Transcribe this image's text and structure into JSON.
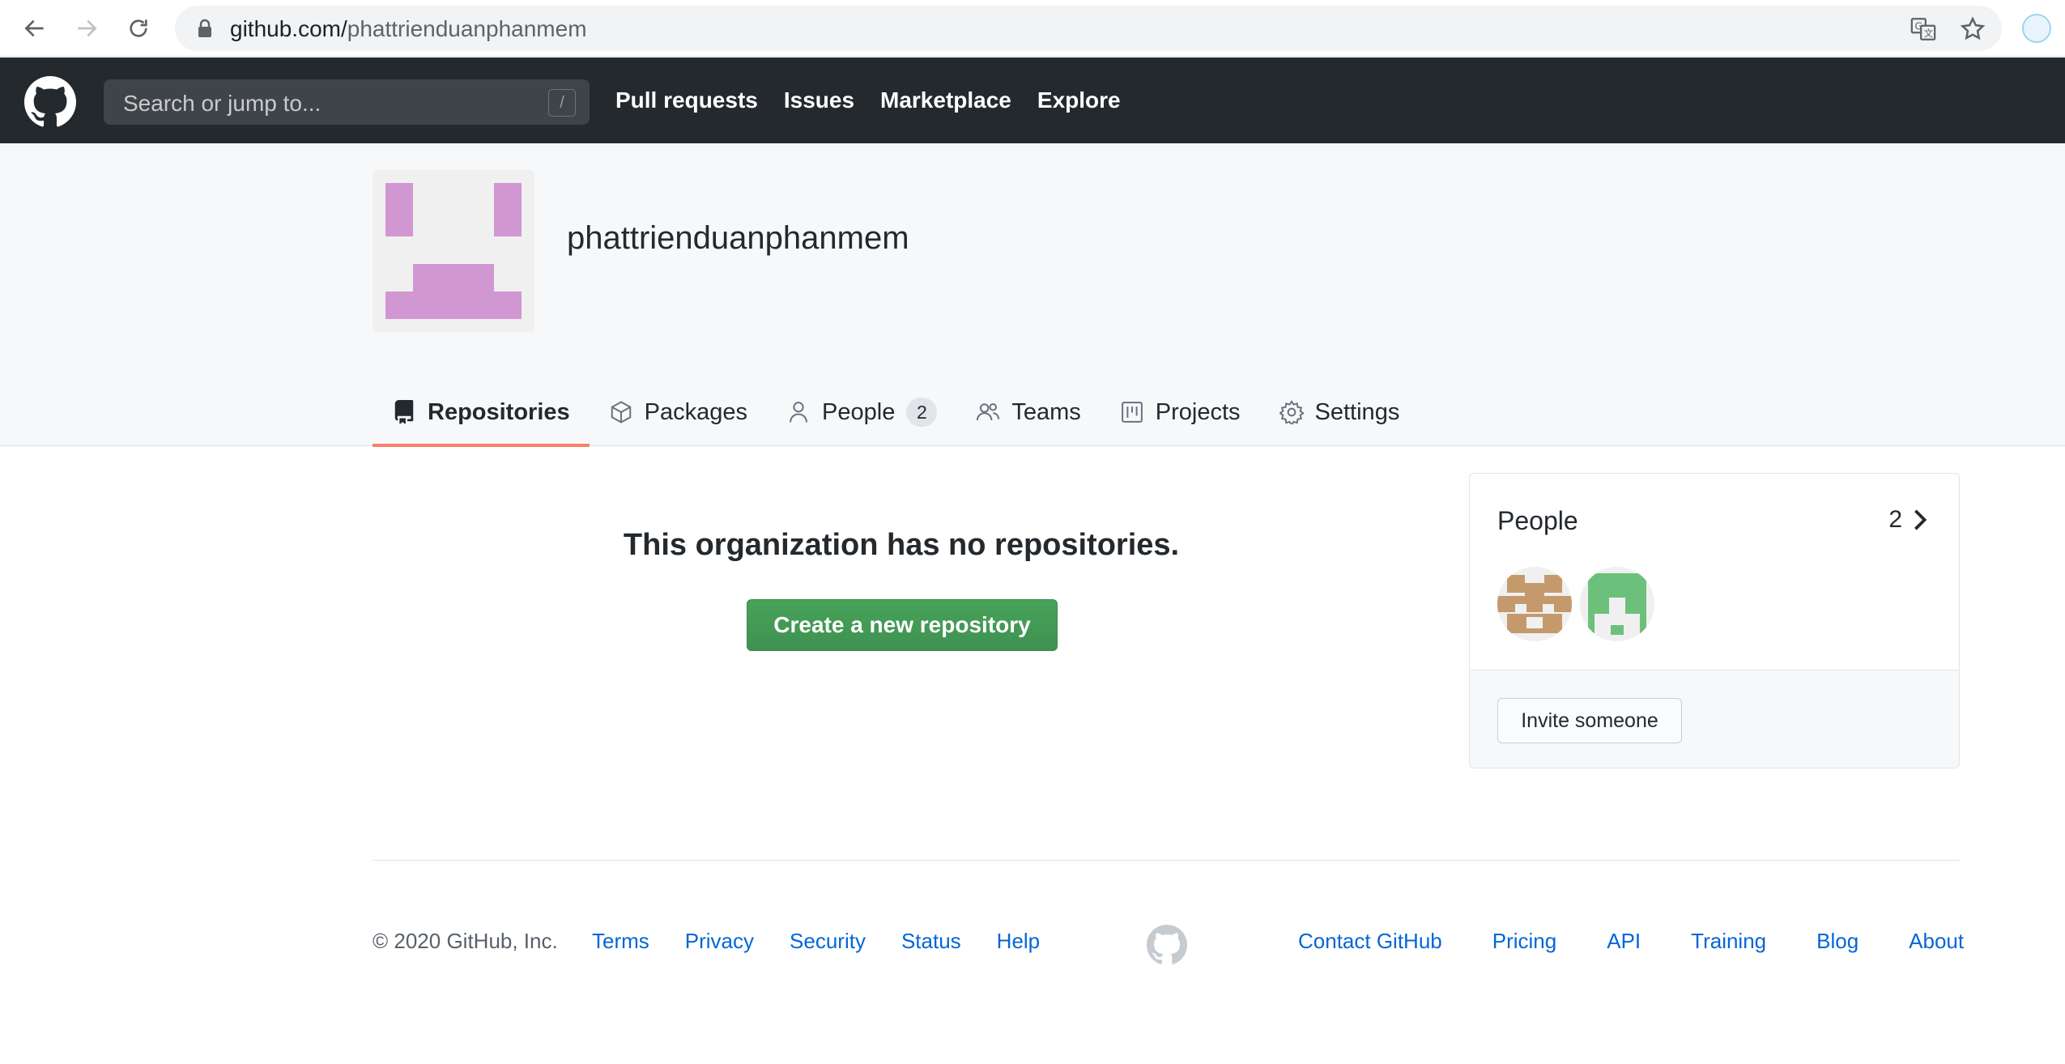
{
  "browser": {
    "url_host": "github.com/",
    "url_path": "phattrienduanphanmem"
  },
  "header": {
    "search_placeholder": "Search or jump to...",
    "search_shortcut": "/",
    "nav": [
      "Pull requests",
      "Issues",
      "Marketplace",
      "Explore"
    ]
  },
  "org": {
    "name": "phattrienduanphanmem",
    "avatar_color": "#d197d3"
  },
  "tabs": [
    {
      "label": "Repositories",
      "icon": "repo-icon",
      "selected": true
    },
    {
      "label": "Packages",
      "icon": "package-icon"
    },
    {
      "label": "People",
      "icon": "person-icon",
      "count": "2"
    },
    {
      "label": "Teams",
      "icon": "people-icon"
    },
    {
      "label": "Projects",
      "icon": "project-icon"
    },
    {
      "label": "Settings",
      "icon": "gear-icon"
    }
  ],
  "main": {
    "empty_title": "This organization has no repositories.",
    "create_button": "Create a new repository"
  },
  "people_box": {
    "title": "People",
    "count": "2",
    "invite_button": "Invite someone",
    "members": [
      {
        "avatar_color": "#c49a6c"
      },
      {
        "avatar_color": "#6cc07c"
      }
    ]
  },
  "footer": {
    "copyright": "© 2020 GitHub, Inc.",
    "left_links": [
      "Terms",
      "Privacy",
      "Security",
      "Status",
      "Help"
    ],
    "right_links": [
      "Contact GitHub",
      "Pricing",
      "API",
      "Training",
      "Blog",
      "About"
    ]
  },
  "colors": {
    "header_bg": "#24292e",
    "selected_tab_underline": "#f9826c",
    "create_button": "#2ea44f",
    "link": "#0366d6"
  }
}
